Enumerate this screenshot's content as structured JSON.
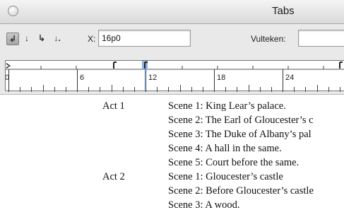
{
  "window": {
    "title": "Tabs"
  },
  "toolbar": {
    "tab_buttons": [
      {
        "icon": "left-justified-tab-icon",
        "glyph": "↲",
        "active": true
      },
      {
        "icon": "center-justified-tab-icon",
        "glyph": "↓",
        "active": false
      },
      {
        "icon": "right-justified-tab-icon",
        "glyph": "↳",
        "active": false
      },
      {
        "icon": "align-to-decimal-tab-icon",
        "glyph": "↓.",
        "active": false
      }
    ],
    "x_label": "X:",
    "x_value": "16p0",
    "leader_label": "Vulteken:",
    "leader_value": ""
  },
  "ruler": {
    "tick_labels": [
      "0",
      "6",
      "12",
      "18",
      "24"
    ]
  },
  "document": {
    "rows": [
      {
        "act": "Act 1",
        "scene": "Scene 1: King Lear’s palace."
      },
      {
        "act": "",
        "scene": "Scene 2: The Earl of Gloucester’s c"
      },
      {
        "act": "",
        "scene": "Scene 3: The Duke of Albany’s pal"
      },
      {
        "act": "",
        "scene": "Scene 4: A hall in the same."
      },
      {
        "act": "",
        "scene": "Scene 5: Court before the same."
      },
      {
        "act": "Act 2",
        "scene": "Scene 1: Gloucester’s castle"
      },
      {
        "act": "",
        "scene": "Scene 2: Before Gloucester’s castle"
      },
      {
        "act": "",
        "scene": "Scene 3: A wood."
      }
    ]
  }
}
